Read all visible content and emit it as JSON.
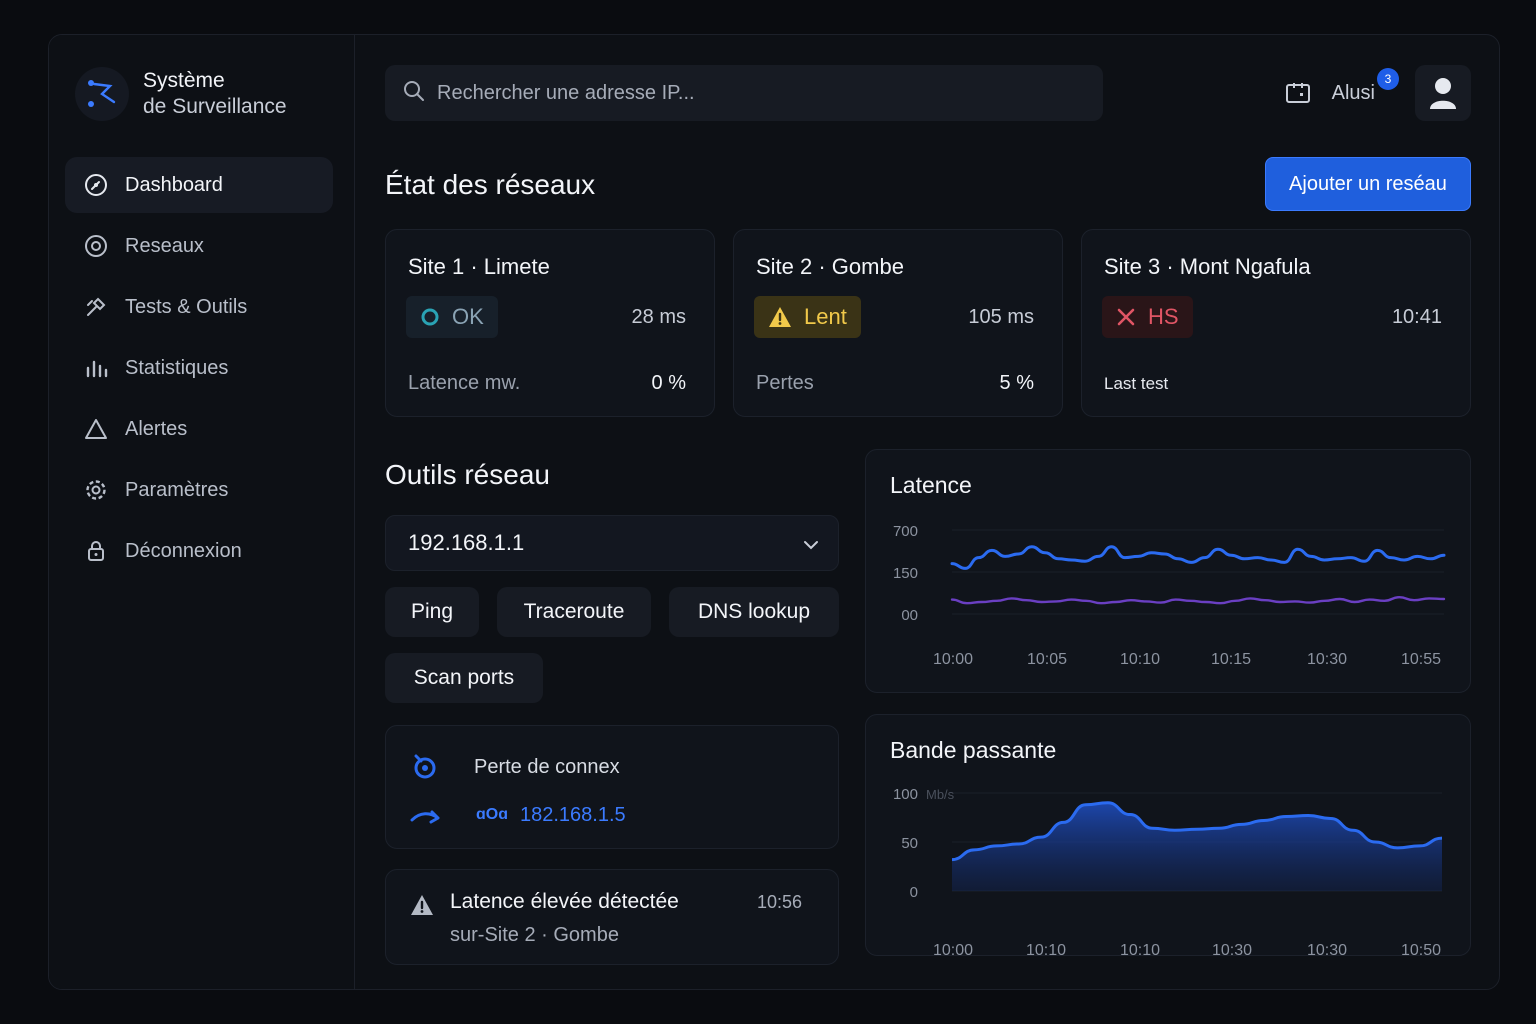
{
  "brand": {
    "line1": "Système",
    "line2": "de Surveillance"
  },
  "nav": [
    {
      "label": "Dashboard",
      "icon": "dashboard-icon",
      "active": true
    },
    {
      "label": "Reseaux",
      "icon": "network-icon"
    },
    {
      "label": "Tests & Outils",
      "icon": "tools-icon"
    },
    {
      "label": "Statistiques",
      "icon": "stats-icon"
    },
    {
      "label": "Alertes",
      "icon": "alert-icon"
    },
    {
      "label": "Paramètres",
      "icon": "gear-icon"
    },
    {
      "label": "Déconnexion",
      "icon": "lock-icon"
    }
  ],
  "search": {
    "placeholder": "Rechercher une adresse IP..."
  },
  "user": {
    "name": "Alusi",
    "notifications": "3"
  },
  "header": {
    "title": "État des réseaux",
    "add_button": "Ajouter un reséau"
  },
  "sites": [
    {
      "title": "Site 1 · Limete",
      "status": "OK",
      "value": "28 ms",
      "label": "Latence mw.",
      "pct": "0 %"
    },
    {
      "title": "Site 2 · Gombe",
      "status": "Lent",
      "value": "105 ms",
      "label": "Pertes",
      "pct": "5 %"
    },
    {
      "title": "Site 3 · Mont Ngafula",
      "status": "HS",
      "value": "10:41",
      "label": "Last test",
      "pct": ""
    }
  ],
  "tools": {
    "title": "Outils réseau",
    "selected_ip": "192.168.1.1",
    "buttons": [
      "Ping",
      "Traceroute",
      "DNS lookup",
      "Scan ports"
    ]
  },
  "events": {
    "connection_loss": {
      "label": "Perte de connex",
      "prefix": "ɑOɑ",
      "ip": "182.168.1.5"
    },
    "latency_alert": {
      "title": "Latence élevée détectée",
      "subtitle": "sur-Site 2 · Gombe",
      "time": "10:56"
    }
  },
  "colors": {
    "accent": "#1f5fdd",
    "ok": "#2aa3b4",
    "warn": "#f1c94a",
    "error": "#e05565",
    "line1": "#2b6bf0",
    "line2": "#6a3fc2"
  },
  "chart_data": [
    {
      "type": "line",
      "title": "Latence",
      "ytick_labels": [
        "700",
        "150",
        "00"
      ],
      "xtick_labels": [
        "10:00",
        "10:05",
        "10:10",
        "10:15",
        "10:30",
        "10:55"
      ],
      "series": [
        {
          "values": [
            420,
            380,
            470,
            530,
            480,
            500,
            560,
            510,
            460,
            450,
            440,
            480,
            560,
            470,
            480,
            510,
            500,
            460,
            430,
            470,
            540,
            490,
            460,
            470,
            450,
            430,
            540,
            480,
            450,
            460,
            470,
            440,
            530,
            470,
            450,
            480,
            460,
            490
          ]
        },
        {
          "values": [
            120,
            90,
            100,
            110,
            130,
            115,
            100,
            105,
            120,
            110,
            90,
            100,
            115,
            105,
            95,
            120,
            110,
            100,
            90,
            110,
            130,
            115,
            100,
            105,
            95,
            110,
            125,
            100,
            120,
            110,
            140,
            115,
            130,
            125
          ]
        }
      ]
    },
    {
      "type": "area",
      "title": "Bande passante",
      "ylabel": "Mb/s",
      "ytick_labels": [
        "100",
        "50",
        "0"
      ],
      "ylim": [
        0,
        100
      ],
      "xtick_labels": [
        "10:00",
        "10:10",
        "10:10",
        "10:30",
        "10:30",
        "10:50"
      ],
      "values": [
        32,
        42,
        46,
        48,
        55,
        70,
        88,
        90,
        78,
        64,
        62,
        63,
        64,
        68,
        72,
        76,
        77,
        74,
        62,
        50,
        44,
        46,
        54
      ]
    }
  ]
}
